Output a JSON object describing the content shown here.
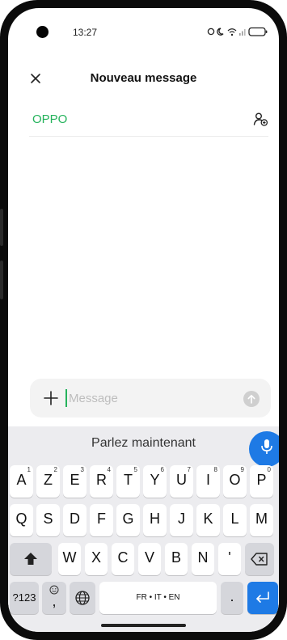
{
  "status_bar": {
    "time": "13:27"
  },
  "header": {
    "title": "Nouveau message",
    "close_icon": "close-icon"
  },
  "recipient": {
    "name": "OPPO",
    "add_contact_icon": "add-contact-icon"
  },
  "composer": {
    "placeholder": "Message",
    "value": ""
  },
  "keyboard": {
    "voice_prompt": "Parlez maintenant",
    "row1": [
      {
        "label": "A",
        "num": "1"
      },
      {
        "label": "Z",
        "num": "2"
      },
      {
        "label": "E",
        "num": "3"
      },
      {
        "label": "R",
        "num": "4"
      },
      {
        "label": "T",
        "num": "5"
      },
      {
        "label": "Y",
        "num": "6"
      },
      {
        "label": "U",
        "num": "7"
      },
      {
        "label": "I",
        "num": "8"
      },
      {
        "label": "O",
        "num": "9"
      },
      {
        "label": "P",
        "num": "0"
      }
    ],
    "row2": [
      "Q",
      "S",
      "D",
      "F",
      "G",
      "H",
      "J",
      "K",
      "L",
      "M"
    ],
    "row3": [
      "W",
      "X",
      "C",
      "V",
      "B",
      "N",
      "'"
    ],
    "symbols_label": "?123",
    "comma_label": ",",
    "space_label": "FR • IT • EN",
    "period_label": ".",
    "colors": {
      "accent_green": "#25b35c",
      "key_blue": "#1e7ae5"
    }
  }
}
